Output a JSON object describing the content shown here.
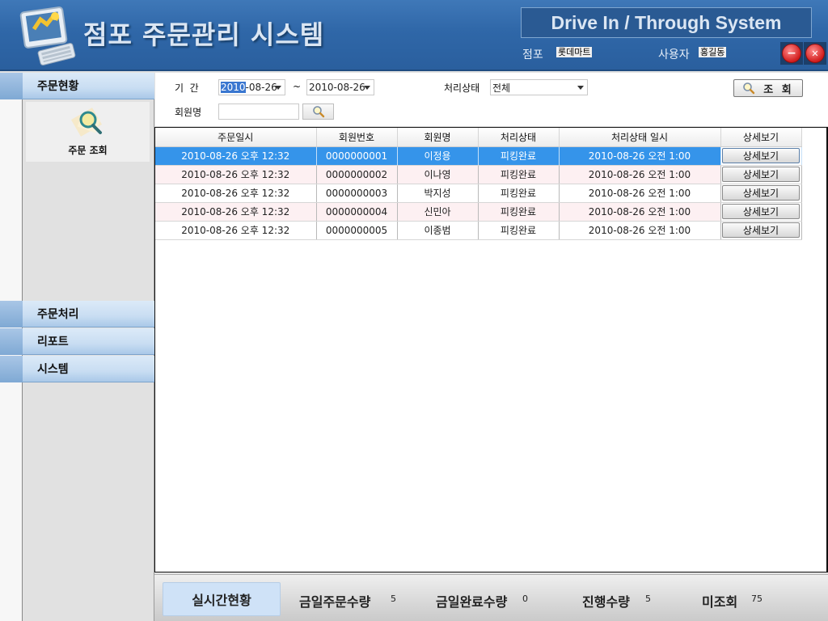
{
  "header": {
    "app_title": "점포 주문관리 시스템",
    "brand": "Drive In / Through System",
    "store_label": "점포",
    "store_value": "롯데마트",
    "user_label": "사용자",
    "user_value": "홍길동",
    "minimize_label": "−",
    "close_label": "✕"
  },
  "sidebar": {
    "sections": [
      {
        "label": "주문현황",
        "expanded": true,
        "items": [
          {
            "label": "주문 조회",
            "icon": "magnifier-icon"
          }
        ]
      },
      {
        "label": "주문처리"
      },
      {
        "label": "리포트"
      },
      {
        "label": "시스템"
      }
    ]
  },
  "filter": {
    "period_label": "기  간",
    "date_from_selected": "2010",
    "date_from_rest": "-08-26",
    "range_sep": "~",
    "date_to": "2010-08-26",
    "status_label": "처리상태",
    "status_value": "전체",
    "member_label": "회원명",
    "member_value": "",
    "search_button": "조 회"
  },
  "grid": {
    "columns": [
      "주문일시",
      "회원번호",
      "회원명",
      "처리상태",
      "처리상태 일시",
      "상세보기"
    ],
    "rows": [
      {
        "order_time": "2010-08-26 오후 12:32",
        "member_no": "0000000001",
        "member_name": "이정용",
        "status": "피킹완료",
        "status_time": "2010-08-26 오전 1:00",
        "detail": "상세보기",
        "selected": true
      },
      {
        "order_time": "2010-08-26 오후 12:32",
        "member_no": "0000000002",
        "member_name": "이나영",
        "status": "피킹완료",
        "status_time": "2010-08-26 오전 1:00",
        "detail": "상세보기"
      },
      {
        "order_time": "2010-08-26 오후 12:32",
        "member_no": "0000000003",
        "member_name": "박지성",
        "status": "피킹완료",
        "status_time": "2010-08-26 오전 1:00",
        "detail": "상세보기"
      },
      {
        "order_time": "2010-08-26 오후 12:32",
        "member_no": "0000000004",
        "member_name": "신민아",
        "status": "피킹완료",
        "status_time": "2010-08-26 오전 1:00",
        "detail": "상세보기"
      },
      {
        "order_time": "2010-08-26 오후 12:32",
        "member_no": "0000000005",
        "member_name": "이종범",
        "status": "피킹완료",
        "status_time": "2010-08-26 오전 1:00",
        "detail": "상세보기"
      }
    ]
  },
  "statusbar": {
    "live_tab": "실시간현황",
    "stats": [
      {
        "label": "금일주문수량",
        "value": "5"
      },
      {
        "label": "금일완료수량",
        "value": "0"
      },
      {
        "label": "진행수량",
        "value": "5"
      },
      {
        "label": "미조회",
        "value": "75"
      }
    ]
  }
}
